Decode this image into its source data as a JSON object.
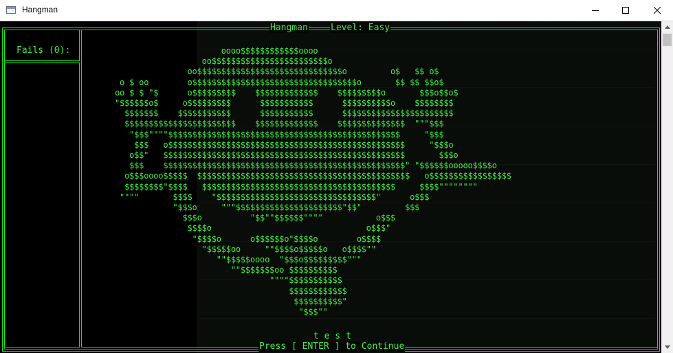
{
  "window": {
    "title": "Hangman",
    "icon": "console-window-icon",
    "controls": {
      "minimize": "minimize-icon",
      "maximize": "maximize-icon",
      "close": "close-icon"
    }
  },
  "game": {
    "title": "Hangman",
    "level_label": "Level: Easy",
    "fails_label": "Fails (0):",
    "word": "t e s t",
    "footer": "Press [ ENTER ] to Continue",
    "art": "                      oooo$$$$$$$$$$$$oooo\n                  oo$$$$$$$$$$$$$$$$$$$$$$$$o\n               oo$$$$$$$$$$$$$$$$$$$$$$$$$$$$$$o         o$   $$ o$\n o $ oo        o$$$$$$$$$$$$$$$$$$$$$$$$$$$$$$$$$$o       $$ $$ $$o$\noo $ $ \"$      o$$$$$$$$$    $$$$$$$$$$$$$    $$$$$$$$$o       $$$o$$o$\n\"$$$$$$o$     o$$$$$$$$$      $$$$$$$$$$$      $$$$$$$$$$o    $$$$$$$$\n  $$$$$$$    $$$$$$$$$$$      $$$$$$$$$$$      $$$$$$$$$$$$$$$$$$$$$$$\n  $$$$$$$$$$$$$$$$$$$$$$$    $$$$$$$$$$$$$    $$$$$$$$$$$$$$  \"\"\"$$$\n   \"$$$\"\"\"\"$$$$$$$$$$$$$$$$$$$$$$$$$$$$$$$$$$$$$$$$$$$$$$$$     \"$$$\n    $$$   o$$$$$$$$$$$$$$$$$$$$$$$$$$$$$$$$$$$$$$$$$$$$$$$$$     \"$$$o\n   o$$\"   $$$$$$$$$$$$$$$$$$$$$$$$$$$$$$$$$$$$$$$$$$$$$$$$$$       $$$o\n   $$$    $$$$$$$$$$$$$$$$$$$$$$$$$$$$$$$$$$$$$$$$$$$$$$$$$$\" \"$$$$$$ooooo$$$$o\n  o$$$oooo$$$$$  $$$$$$$$$$$$$$$$$$$$$$$$$$$$$$$$$$$$$$$$$$$$   o$$$$$$$$$$$$$$$$$\n  $$$$$$$$\"$$$$   $$$$$$$$$$$$$$$$$$$$$$$$$$$$$$$$$$$$$$$$     $$$$\"\"\"\"\"\"\"\"\n \"\"\"\"       $$$$    \"$$$$$$$$$$$$$$$$$$$$$$$$$$$$$$$$$\"      o$$$\n            \"$$$o     \"\"\"$$$$$$$$$$$$$$$$$$$$$$\"$$\"         $$$\n              $$$o          \"$$\"\"$$$$$$\"\"\"\"           o$$$\n               $$$$o                                o$$$\"\n                \"$$$$o      o$$$$$$o\"$$$$o        o$$$$\n                  \"$$$$$oo     \"\"$$$$o$$$$$o   o$$$$\"\"\n                     \"\"$$$$$oooo  \"$$$o$$$$$$$$$\"\"\"\n                        \"\"$$$$$$$oo $$$$$$$$$$\n                                \"\"\"\"$$$$$$$$$$$\n                                    $$$$$$$$$$$$\n                                     $$$$$$$$$$\"\n                                      \"$$$\"\""
  }
}
